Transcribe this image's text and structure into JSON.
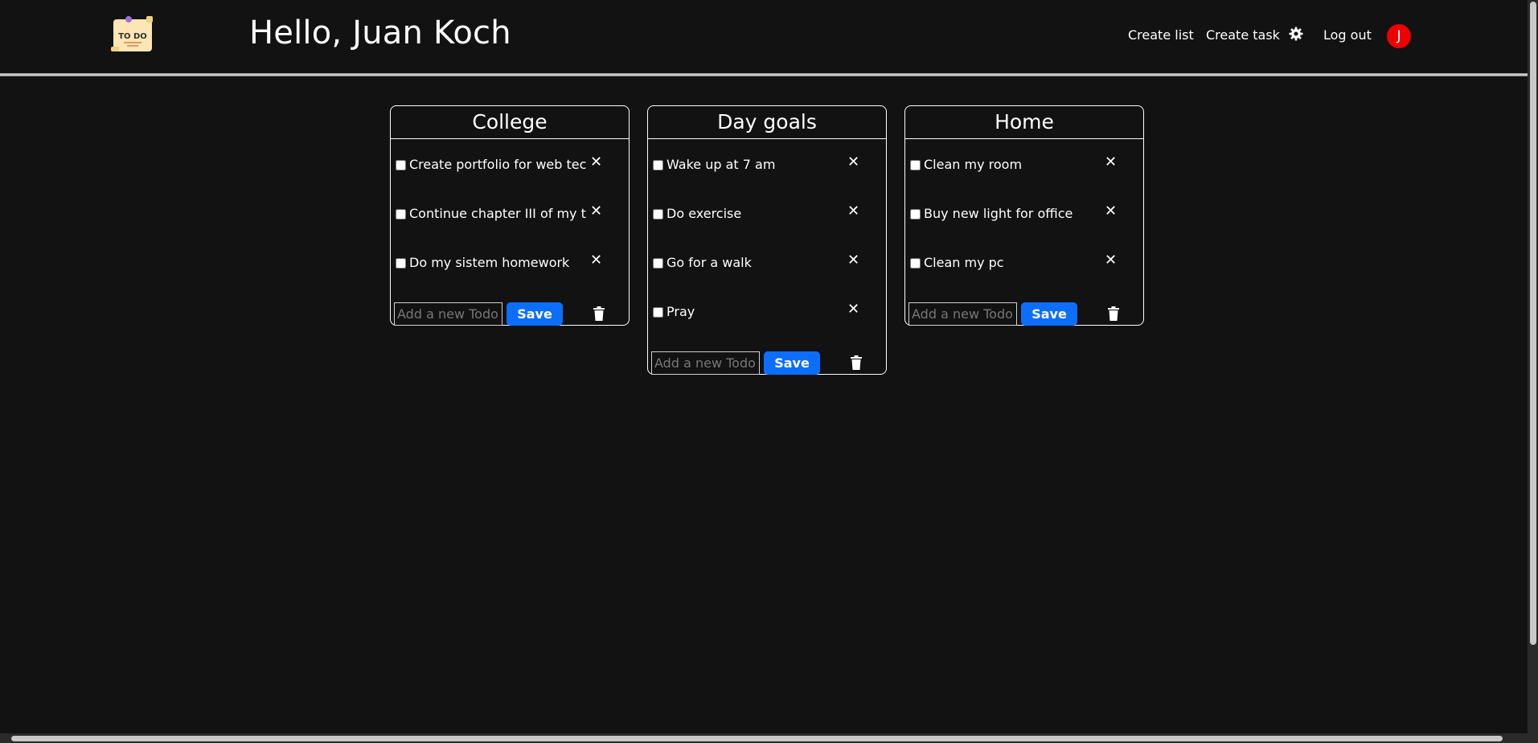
{
  "app": {
    "logo_text": "TO DO",
    "greeting": "Hello, Juan Koch"
  },
  "nav": {
    "create_list": "Create list",
    "create_task": "Create task",
    "settings_icon": "gear-icon",
    "logout": "Log out",
    "avatar_initial": "J",
    "avatar_color": "#ee0000"
  },
  "colors": {
    "background": "#121212",
    "accent": "#0d6efd"
  },
  "lists": [
    {
      "title": "College",
      "tasks": [
        {
          "label": "Create portfolio for web tech",
          "checked": false
        },
        {
          "label": "Continue chapter III of my tesis",
          "checked": false
        },
        {
          "label": "Do my sistem homework",
          "checked": false
        }
      ],
      "input_placeholder": "Add a new Todo!!",
      "save_label": "Save"
    },
    {
      "title": "Day goals",
      "tasks": [
        {
          "label": "Wake up at 7 am",
          "checked": false
        },
        {
          "label": "Do exercise",
          "checked": false
        },
        {
          "label": "Go for a walk",
          "checked": false
        },
        {
          "label": "Pray",
          "checked": false
        }
      ],
      "input_placeholder": "Add a new Todo!!",
      "save_label": "Save"
    },
    {
      "title": "Home",
      "tasks": [
        {
          "label": "Clean my room",
          "checked": false
        },
        {
          "label": "Buy new light for office",
          "checked": false
        },
        {
          "label": "Clean my pc",
          "checked": false
        }
      ],
      "input_placeholder": "Add a new Todo!!",
      "save_label": "Save"
    }
  ]
}
